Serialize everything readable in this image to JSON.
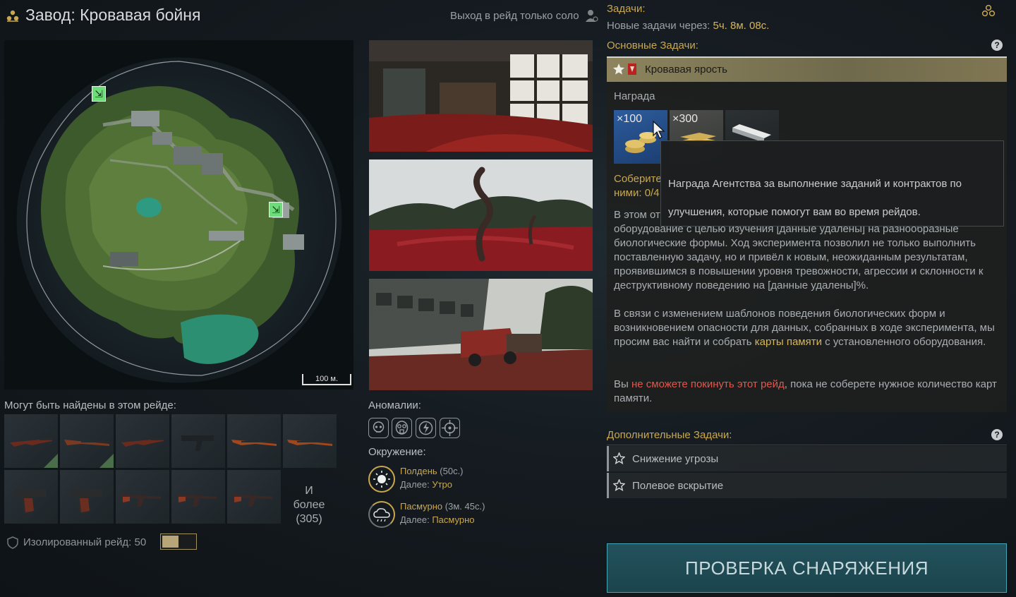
{
  "header": {
    "title": "Завод: Кровавая бойня",
    "solo_label": "Выход в рейд только соло"
  },
  "map": {
    "scale_label": "100 м."
  },
  "loot": {
    "title": "Могут быть найдены в этом рейде:",
    "more_label": "И более",
    "more_count": "(305)",
    "items": [
      {
        "icon": "rifle-icon",
        "found": true
      },
      {
        "icon": "shotgun-icon",
        "found": true
      },
      {
        "icon": "rifle-icon",
        "found": false
      },
      {
        "icon": "smg-icon",
        "found": false
      },
      {
        "icon": "sniper-rifle-icon",
        "found": false
      },
      {
        "icon": "sniper-rifle-icon",
        "found": false
      },
      {
        "icon": "pistol-icon",
        "found": false
      },
      {
        "icon": "pistol-icon",
        "found": false
      },
      {
        "icon": "assault-rifle-icon",
        "found": false
      },
      {
        "icon": "assault-rifle-icon",
        "found": false
      },
      {
        "icon": "assault-rifle-icon",
        "found": false
      }
    ]
  },
  "isolated": {
    "label": "Изолированный рейд: 50",
    "progress": 0.5
  },
  "anomalies": {
    "title": "Аномалии:",
    "icons": [
      "skull-icon",
      "gas-mask-icon",
      "lightning-icon",
      "target-icon"
    ]
  },
  "environment": {
    "title": "Окружение:",
    "items": [
      {
        "icon": "sun-icon",
        "name": "Полдень",
        "time": "(50с.)",
        "next_label": "Далее:",
        "next_value": "Утро"
      },
      {
        "icon": "cloud-rain-icon",
        "name": "Пасмурно",
        "time": "(3м. 45с.)",
        "next_label": "Далее:",
        "next_value": "Пасмурно"
      }
    ]
  },
  "tasks": {
    "title": "Задачи:",
    "new_tasks_label": "Новые задачи через:",
    "new_tasks_time": "5ч. 8м. 08с.",
    "main_title": "Основные Задачи:",
    "main_quest": {
      "title": "Кровавая ярость",
      "reward_label": "Награда",
      "rewards": [
        {
          "qty": "×100",
          "icon": "coins-icon"
        },
        {
          "qty": "×300",
          "icon": "gold-bars-icon"
        },
        {
          "qty": "",
          "icon": "device-icon"
        }
      ],
      "objective_prefix": "Соберите",
      "objective_suffix": "ними: 0/4",
      "para1": "В этом от… оборудование с целью изучения [данные удалены] на разнообразные биологические формы. Ход эксперимента позволил не только выполнить поставленную задачу, но и привёл к новым, неожиданным результатам, проявившимся в повышении уровня тревожности, агрессии и склонности к деструктивному поведению на [данные удалены]%.",
      "para1_line1": "В этом от",
      "para1_line2": "оборудование с целью изучения [данные удалены] на разнообразные",
      "para1_line3": "биологические формы. Ход эксперимента позволил не только выполнить",
      "para1_line4": "поставленную задачу, но и привёл к новым, неожиданным результатам,",
      "para1_line5": "проявившимся в повышении уровня тревожности, агрессии и склонности к",
      "para1_line6": "деструктивному поведению на [данные удалены]%.",
      "para2_a": "В связи с изменением шаблонов поведения биологических форм и возникновением опасности для данных, собранных в ходе эксперимента, мы просим вас найти и собрать ",
      "para2_highlight": "карты памяти",
      "para2_b": " с установленного оборудования.",
      "para3_a": "Вы ",
      "para3_highlight": "не сможете покинуть этот рейд",
      "para3_b": ", пока не соберете нужное количество карт памяти."
    },
    "tooltip": {
      "line1": "Награда Агентства за выполнение заданий и контрактов по",
      "line2": "улучшения, которые помогут вам во время рейдов."
    },
    "extra_title": "Дополнительные Задачи:",
    "extra_items": [
      {
        "label": "Снижение угрозы"
      },
      {
        "label": "Полевое вскрытие"
      }
    ]
  },
  "button": {
    "label": "ПРОВЕРКА СНАРЯЖЕНИЯ"
  },
  "colors": {
    "accent_gold": "#c9a74e",
    "highlight_red": "#e0574c",
    "button_border": "#46a6b4"
  }
}
